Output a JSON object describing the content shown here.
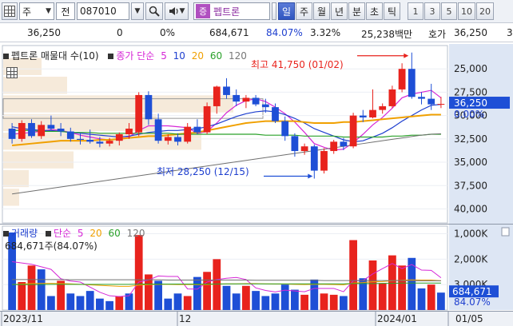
{
  "toolbar": {
    "market": "주",
    "chart_type": "전",
    "code": "087010",
    "name_tag": "증",
    "name": "펩트론",
    "periods": [
      "일",
      "주",
      "월",
      "년",
      "분",
      "초",
      "틱"
    ],
    "active_period": "일",
    "intervals": [
      "1",
      "3",
      "5",
      "10",
      "20"
    ]
  },
  "quote": {
    "price": "36,250",
    "change": "0",
    "change_pct": "0%",
    "volume": "684,671",
    "volume_ratio": "84.07%",
    "turnover_pct": "3.32%",
    "amount": "25,238백만",
    "bid_label": "호가",
    "bid": "36,250",
    "extra": "3"
  },
  "price_panel": {
    "title": "펩트론 매물대 수(10)",
    "ma_label": "종가 단순",
    "ma_periods": [
      "5",
      "10",
      "20",
      "60",
      "120"
    ],
    "high_annotation": "최고 41,750 (01/02)",
    "low_annotation": "최저 28,250 (12/15)",
    "y_ticks": [
      "40,000",
      "37,500",
      "35,000",
      "32,500",
      "30,000",
      "27,500",
      "25,000"
    ],
    "current_price_label": "36,250",
    "current_pct_label": "0.00%"
  },
  "volume_panel": {
    "title": "거래량",
    "ma_label": "단순",
    "ma_periods": [
      "5",
      "20",
      "60",
      "120"
    ],
    "current_annotation": "684,671주(84.07%)",
    "y_ticks": [
      "3,000K",
      "2,000K",
      "1,000K"
    ],
    "current_volume_label": "684,671",
    "current_pct_label": "84.07%"
  },
  "x_axis": {
    "labels": [
      "2023/11",
      "12",
      "2024/01"
    ],
    "cursor_date": "01/05"
  },
  "colors": {
    "up": "#e8231d",
    "down": "#1e4fd6",
    "ma5": "#d627d6",
    "ma10": "#1e3fcf",
    "ma20": "#f0a000",
    "ma60": "#2aa12a",
    "ma120": "#707070",
    "volume_profile": "#f5e6d3"
  },
  "chart_data": [
    {
      "type": "candlestick",
      "title": "펩트론 매물대 수(10)",
      "ylim": [
        23500,
        42500
      ],
      "y_ticks": [
        25000,
        27500,
        30000,
        32500,
        35000,
        37500,
        40000
      ],
      "candles": [
        {
          "o": 33600,
          "h": 34200,
          "l": 32000,
          "c": 32500
        },
        {
          "o": 32500,
          "h": 34500,
          "l": 32200,
          "c": 34200
        },
        {
          "o": 34200,
          "h": 34600,
          "l": 32600,
          "c": 32800
        },
        {
          "o": 32800,
          "h": 34400,
          "l": 32500,
          "c": 34000
        },
        {
          "o": 34000,
          "h": 35000,
          "l": 33400,
          "c": 33600
        },
        {
          "o": 33600,
          "h": 34200,
          "l": 32800,
          "c": 33300
        },
        {
          "o": 33300,
          "h": 33700,
          "l": 32200,
          "c": 32500
        },
        {
          "o": 32500,
          "h": 33100,
          "l": 31900,
          "c": 32400
        },
        {
          "o": 32400,
          "h": 33500,
          "l": 32000,
          "c": 32200
        },
        {
          "o": 32200,
          "h": 32700,
          "l": 31600,
          "c": 32000
        },
        {
          "o": 32000,
          "h": 32600,
          "l": 31700,
          "c": 32300
        },
        {
          "o": 32300,
          "h": 33200,
          "l": 31800,
          "c": 33000
        },
        {
          "o": 33000,
          "h": 34200,
          "l": 32500,
          "c": 33600
        },
        {
          "o": 33200,
          "h": 37500,
          "l": 32800,
          "c": 37200
        },
        {
          "o": 37200,
          "h": 37600,
          "l": 34000,
          "c": 34600
        },
        {
          "o": 34600,
          "h": 35200,
          "l": 32000,
          "c": 32300
        },
        {
          "o": 32300,
          "h": 33000,
          "l": 31900,
          "c": 32700
        },
        {
          "o": 32700,
          "h": 33100,
          "l": 31800,
          "c": 32200
        },
        {
          "o": 32200,
          "h": 34200,
          "l": 32000,
          "c": 33800
        },
        {
          "o": 33800,
          "h": 34600,
          "l": 33000,
          "c": 33200
        },
        {
          "o": 33200,
          "h": 36400,
          "l": 33000,
          "c": 36000
        },
        {
          "o": 36000,
          "h": 38200,
          "l": 35200,
          "c": 38100
        },
        {
          "o": 38100,
          "h": 39000,
          "l": 36800,
          "c": 37200
        },
        {
          "o": 37200,
          "h": 37800,
          "l": 36000,
          "c": 36500
        },
        {
          "o": 36500,
          "h": 37200,
          "l": 35800,
          "c": 36900
        },
        {
          "o": 36900,
          "h": 37200,
          "l": 36000,
          "c": 36200
        },
        {
          "o": 36200,
          "h": 36800,
          "l": 35300,
          "c": 35900
        },
        {
          "o": 35900,
          "h": 36300,
          "l": 34200,
          "c": 34400
        },
        {
          "o": 34400,
          "h": 34900,
          "l": 32300,
          "c": 32800
        },
        {
          "o": 32800,
          "h": 33100,
          "l": 30600,
          "c": 31200
        },
        {
          "o": 31200,
          "h": 32000,
          "l": 30800,
          "c": 31700
        },
        {
          "o": 31700,
          "h": 31900,
          "l": 28250,
          "c": 29100
        },
        {
          "o": 29100,
          "h": 31500,
          "l": 28800,
          "c": 31200
        },
        {
          "o": 31200,
          "h": 32400,
          "l": 30900,
          "c": 32200
        },
        {
          "o": 32200,
          "h": 32600,
          "l": 31300,
          "c": 31700
        },
        {
          "o": 31700,
          "h": 35300,
          "l": 31500,
          "c": 35000
        },
        {
          "o": 35000,
          "h": 35600,
          "l": 34300,
          "c": 34800
        },
        {
          "o": 34800,
          "h": 37800,
          "l": 34700,
          "c": 35600
        },
        {
          "o": 35600,
          "h": 36300,
          "l": 35200,
          "c": 36000
        },
        {
          "o": 36000,
          "h": 38200,
          "l": 35800,
          "c": 37800
        },
        {
          "o": 37800,
          "h": 40600,
          "l": 37500,
          "c": 40000
        },
        {
          "o": 40000,
          "h": 41750,
          "l": 36800,
          "c": 37000
        },
        {
          "o": 37000,
          "h": 37500,
          "l": 36200,
          "c": 36800
        },
        {
          "o": 36800,
          "h": 38400,
          "l": 35600,
          "c": 36200
        },
        {
          "o": 36200,
          "h": 37000,
          "l": 35800,
          "c": 36250
        }
      ],
      "moving_averages": {
        "ma5": [
          33000,
          33100,
          33200,
          33300,
          33500,
          33400,
          33200,
          32900,
          32700,
          32500,
          32400,
          32500,
          32700,
          33400,
          33900,
          33900,
          33900,
          33800,
          33700,
          33100,
          33300,
          34200,
          35300,
          36100,
          36600,
          36800,
          36500,
          35900,
          35200,
          34300,
          33200,
          32000,
          31600,
          31300,
          31400,
          32100,
          33000,
          34000,
          34800,
          35800,
          36900,
          37300,
          37500,
          37700,
          36900
        ],
        "ma10": [
          33800,
          33600,
          33500,
          33400,
          33400,
          33300,
          33200,
          33100,
          33000,
          32900,
          32800,
          32700,
          32800,
          33000,
          33200,
          33300,
          33400,
          33400,
          33500,
          33600,
          33800,
          34100,
          34500,
          34900,
          35200,
          35400,
          35500,
          35400,
          35100,
          34700,
          34200,
          33600,
          33200,
          32800,
          32400,
          32200,
          32300,
          32700,
          33100,
          33700,
          34400,
          35000,
          35600,
          36100,
          36200
        ],
        "ma20": [
          31800,
          31900,
          32000,
          32100,
          32200,
          32300,
          32300,
          32300,
          32300,
          32400,
          32400,
          32500,
          32600,
          32700,
          32800,
          32800,
          32900,
          33000,
          33100,
          33200,
          33400,
          33600,
          33800,
          34000,
          34200,
          34300,
          34400,
          34400,
          34400,
          34400,
          34300,
          34200,
          34200,
          34200,
          34300,
          34300,
          34400,
          34500,
          34600,
          34700,
          34800,
          34900,
          35000,
          35100,
          35100
        ],
        "ma60": [
          33400,
          33400,
          33400,
          33300,
          33300,
          33300,
          33200,
          33200,
          33200,
          33100,
          33100,
          33100,
          33100,
          33100,
          33100,
          33100,
          33100,
          33000,
          33000,
          33000,
          33000,
          33000,
          33000,
          33000,
          33000,
          33000,
          32900,
          32900,
          32900,
          32900,
          32800,
          32800,
          32800,
          32800,
          32700,
          32700,
          32700,
          32700,
          32700,
          32800,
          32800,
          32900,
          32900,
          33000,
          33000
        ],
        "ma120": [
          26600,
          26750,
          26900,
          27050,
          27200,
          27350,
          27500,
          27650,
          27800,
          27950,
          28100,
          28250,
          28400,
          28550,
          28700,
          28850,
          29000,
          29150,
          29300,
          29450,
          29600,
          29750,
          29900,
          30050,
          30200,
          30350,
          30500,
          30650,
          30800,
          30950,
          31100,
          31250,
          31400,
          31550,
          31700,
          31850,
          32000,
          32150,
          32300,
          32450,
          32600,
          32750,
          32900,
          33000,
          33050
        ]
      },
      "volume_profile": [
        {
          "price": 26250,
          "weight": 0.05
        },
        {
          "price": 28250,
          "weight": 0.08
        },
        {
          "price": 30250,
          "weight": 0.22
        },
        {
          "price": 32250,
          "weight": 0.62
        },
        {
          "price": 34250,
          "weight": 0.48
        },
        {
          "price": 36250,
          "weight": 0.72
        },
        {
          "price": 38250,
          "weight": 0.2
        },
        {
          "price": 40250,
          "weight": 0.12
        }
      ],
      "annotations": [
        {
          "text": "최고 41,750 (01/02)",
          "index": 41,
          "value": 41750
        },
        {
          "text": "최저 28,250 (12/15)",
          "index": 31,
          "value": 28250
        }
      ]
    },
    {
      "type": "bar",
      "title": "거래량",
      "ylim": [
        0,
        3300
      ],
      "y_unit": "K",
      "y_ticks": [
        1000,
        2000,
        3000
      ],
      "values": [
        3050,
        1100,
        1750,
        1600,
        550,
        1150,
        650,
        550,
        750,
        450,
        350,
        550,
        650,
        2950,
        1400,
        1150,
        450,
        650,
        550,
        1300,
        1500,
        2000,
        950,
        650,
        950,
        750,
        550,
        650,
        1000,
        800,
        600,
        1200,
        650,
        600,
        550,
        2750,
        1250,
        1950,
        1050,
        2150,
        1750,
        2050,
        850,
        1000,
        685
      ],
      "up": [
        false,
        true,
        true,
        false,
        false,
        true,
        false,
        false,
        false,
        false,
        false,
        true,
        false,
        true,
        true,
        false,
        false,
        false,
        true,
        false,
        true,
        true,
        false,
        false,
        true,
        false,
        false,
        false,
        false,
        false,
        true,
        false,
        true,
        true,
        false,
        true,
        false,
        true,
        true,
        true,
        true,
        false,
        false,
        true,
        false
      ],
      "moving_averages": {
        "ma5": [
          1900,
          1850,
          1800,
          1700,
          1600,
          1230,
          1140,
          1100,
          900,
          700,
          560,
          530,
          560,
          1100,
          1180,
          1340,
          1320,
          1320,
          830,
          820,
          1100,
          1200,
          1250,
          1280,
          1200,
          870,
          770,
          710,
          780,
          750,
          720,
          850,
          850,
          850,
          720,
          1150,
          1160,
          1420,
          1630,
          1830,
          1630,
          1790,
          1570,
          1560,
          1270
        ],
        "ma20": [
          1000,
          1020,
          1040,
          1050,
          1050,
          1040,
          1030,
          1010,
          990,
          970,
          950,
          930,
          930,
          980,
          1000,
          1010,
          1010,
          1000,
          1000,
          1000,
          1000,
          1020,
          1030,
          1030,
          1040,
          1040,
          1030,
          1020,
          1020,
          1010,
          1000,
          1010,
          1010,
          1000,
          990,
          1060,
          1080,
          1110,
          1120,
          1150,
          1170,
          1190,
          1180,
          1180,
          1150
        ],
        "ma60": [
          1000,
          1000,
          1000,
          1000,
          1010,
          1010,
          1010,
          1010,
          1010,
          1010,
          1010,
          1010,
          1010,
          1020,
          1020,
          1020,
          1020,
          1020,
          1020,
          1020,
          1020,
          1020,
          1030,
          1030,
          1030,
          1030,
          1030,
          1030,
          1030,
          1030,
          1030,
          1030,
          1030,
          1030,
          1030,
          1040,
          1040,
          1040,
          1050,
          1050,
          1060,
          1060,
          1060,
          1060,
          1060
        ],
        "ma120": [
          1200,
          1200,
          1200,
          1200,
          1200,
          1200,
          1190,
          1190,
          1190,
          1190,
          1190,
          1190,
          1190,
          1190,
          1190,
          1190,
          1180,
          1180,
          1180,
          1180,
          1180,
          1180,
          1180,
          1180,
          1180,
          1170,
          1170,
          1170,
          1170,
          1170,
          1170,
          1170,
          1160,
          1160,
          1160,
          1160,
          1160,
          1160,
          1160,
          1160,
          1160,
          1150,
          1150,
          1150,
          1150
        ]
      }
    }
  ]
}
